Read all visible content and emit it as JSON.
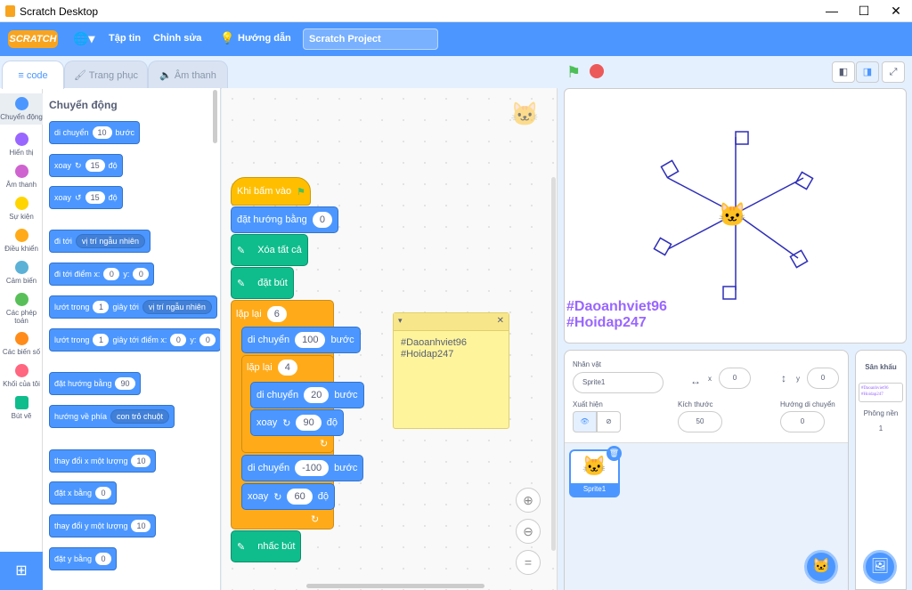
{
  "window": {
    "title": "Scratch Desktop",
    "minimize": "—",
    "maximize": "☐",
    "close": "✕"
  },
  "menu": {
    "logo": "SCRATCH",
    "file": "Tập tin",
    "edit": "Chỉnh sửa",
    "tutorials": "Hướng dẫn",
    "project_name": "Scratch Project",
    "language_icon": "globe-icon"
  },
  "tabs": {
    "code": "code",
    "costumes": "Trang phục",
    "sounds": "Âm thanh"
  },
  "categories": [
    {
      "label": "Chuyển động",
      "color": "#4c97ff"
    },
    {
      "label": "Hiển thị",
      "color": "#9966ff"
    },
    {
      "label": "Âm thanh",
      "color": "#cf63cf"
    },
    {
      "label": "Sự kiện",
      "color": "#ffd500"
    },
    {
      "label": "Điều khiển",
      "color": "#ffab19"
    },
    {
      "label": "Cảm biến",
      "color": "#5cb1d6"
    },
    {
      "label": "Các phép toán",
      "color": "#59c059"
    },
    {
      "label": "Các biến số",
      "color": "#ff8c1a"
    },
    {
      "label": "Khối của tôi",
      "color": "#ff6680"
    },
    {
      "label": "Bút vẽ",
      "color": "#0fbd8c"
    }
  ],
  "palette": {
    "heading": "Chuyển động",
    "move": "di chuyển",
    "move_val": "10",
    "move_unit": "bước",
    "turn_right": "xoay",
    "turn_right_val": "15",
    "deg": "độ",
    "turn_left": "xoay",
    "turn_left_val": "15",
    "goto": "đi tới",
    "goto_opt": "vị trí ngẫu nhiên",
    "goto_xy": "đi tới điểm x:",
    "x_val": "0",
    "y_lbl": "y:",
    "y_val": "0",
    "glide": "lướt trong",
    "glide_val": "1",
    "glide_to": "giây tới",
    "glide_opt": "vị trí ngẫu nhiên",
    "glide_xy": "giây tới điểm x:",
    "glide_y_lbl": "y:",
    "point_dir": "đặt hướng bằng",
    "point_val": "90",
    "point_towards": "hướng về phía",
    "point_opt": "con trỏ chuột",
    "change_x": "thay đổi x một lượng",
    "change_x_val": "10",
    "set_x": "đặt x bằng",
    "set_x_val": "0",
    "change_y": "thay đổi y một lượng",
    "change_y_val": "10",
    "set_y": "đặt y bằng",
    "set_y_val": "0"
  },
  "script": {
    "when_flag": "Khi bấm vào",
    "set_dir": "đặt hướng bằng",
    "set_dir_val": "0",
    "clear": "Xóa tất cả",
    "pen_down": "đặt bút",
    "repeat": "lặp lại",
    "repeat_val": "6",
    "move1": "di chuyển",
    "move1_val": "100",
    "steps": "bước",
    "repeat2": "lặp lại",
    "repeat2_val": "4",
    "move2": "di chuyển",
    "move2_val": "20",
    "turn1": "xoay",
    "turn1_val": "90",
    "deg": "độ",
    "move3": "di chuyển",
    "move3_val": "-100",
    "turn2": "xoay",
    "turn2_val": "60",
    "pen_up": "nhấc bút"
  },
  "note": {
    "line1": "#Daoanhviet96",
    "line2": "#Hoidap247"
  },
  "stage": {
    "text1": "#Daoanhviet96",
    "text2": "#Hoidap247"
  },
  "sprite_info": {
    "sprite_label": "Nhân vật",
    "sprite_name": "Sprite1",
    "x_label": "x",
    "x_val": "0",
    "y_label": "y",
    "y_val": "0",
    "show_label": "Xuất hiện",
    "size_label": "Kích thước",
    "size_val": "50",
    "dir_label": "Hướng di chuyển",
    "dir_val": "0",
    "thumb_name": "Sprite1"
  },
  "backdrop": {
    "label": "Sân khấu",
    "thumb_line1": "#Daoanhviet96",
    "thumb_line2": "#Hoidap247",
    "bg_label": "Phông nền",
    "bg_count": "1"
  },
  "colors": {
    "accent": "#4c97ff",
    "motion": "#4c97ff",
    "pen": "#0fbd8c",
    "control": "#ffab19",
    "event": "#ffbf00",
    "looks": "#9966ff"
  }
}
